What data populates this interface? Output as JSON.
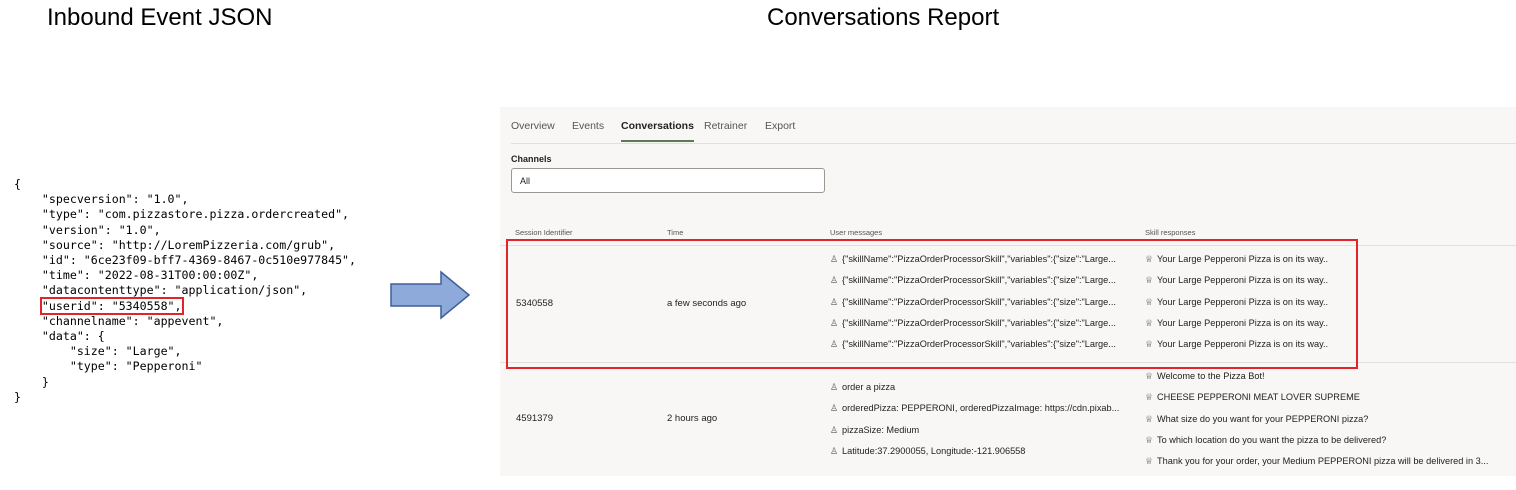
{
  "left_title": "Inbound Event JSON",
  "right_title": "Conversations Report",
  "json_lines": [
    "{",
    "    \"specversion\": \"1.0\",",
    "    \"type\": \"com.pizzastore.pizza.ordercreated\",",
    "    \"version\": \"1.0\",",
    "    \"source\": \"http://LoremPizzeria.com/grub\",",
    "    \"id\": \"6ce23f09-bff7-4369-8467-0c510e977845\",",
    "    \"time\": \"2022-08-31T00:00:00Z\",",
    "    \"datacontenttype\": \"application/json\",",
    "    \"userid\": \"5340558\",",
    "    \"channelname\": \"appevent\",",
    "    \"data\": {",
    "        \"size\": \"Large\",",
    "        \"type\": \"Pepperoni\"",
    "    }",
    "}"
  ],
  "highlight_color": "#e0242b",
  "tabs": [
    "Overview",
    "Events",
    "Conversations",
    "Retrainer",
    "Export"
  ],
  "active_tab": "Conversations",
  "channels": {
    "label": "Channels",
    "value": "All"
  },
  "columns": [
    "Session Identifier",
    "Time",
    "User messages",
    "Skill responses"
  ],
  "rows": [
    {
      "session": "5340558",
      "time": "a few seconds ago",
      "user": [
        "{\"skillName\":\"PizzaOrderProcessorSkill\",\"variables\":{\"size\":\"Large...",
        "{\"skillName\":\"PizzaOrderProcessorSkill\",\"variables\":{\"size\":\"Large...",
        "{\"skillName\":\"PizzaOrderProcessorSkill\",\"variables\":{\"size\":\"Large...",
        "{\"skillName\":\"PizzaOrderProcessorSkill\",\"variables\":{\"size\":\"Large...",
        "{\"skillName\":\"PizzaOrderProcessorSkill\",\"variables\":{\"size\":\"Large..."
      ],
      "skill": [
        "Your Large Pepperoni Pizza is on its way..",
        "Your Large Pepperoni Pizza is on its way..",
        "Your Large Pepperoni Pizza is on its way..",
        "Your Large Pepperoni Pizza is on its way..",
        "Your Large Pepperoni Pizza is on its way.."
      ]
    },
    {
      "session": "4591379",
      "time": "2 hours ago",
      "user": [
        "order a pizza",
        "orderedPizza: PEPPERONI, orderedPizzaImage: https://cdn.pixab...",
        "pizzaSize: Medium",
        "Latitude:37.2900055, Longitude:-121.906558"
      ],
      "skill": [
        "Welcome to the Pizza Bot!",
        "CHEESE PEPPERONI MEAT LOVER SUPREME",
        "What size do you want for your PEPPERONI pizza?",
        "To which location do you want the pizza to be delivered?",
        "Thank you for your order, your Medium PEPPERONI pizza will be delivered in 3..."
      ]
    }
  ]
}
